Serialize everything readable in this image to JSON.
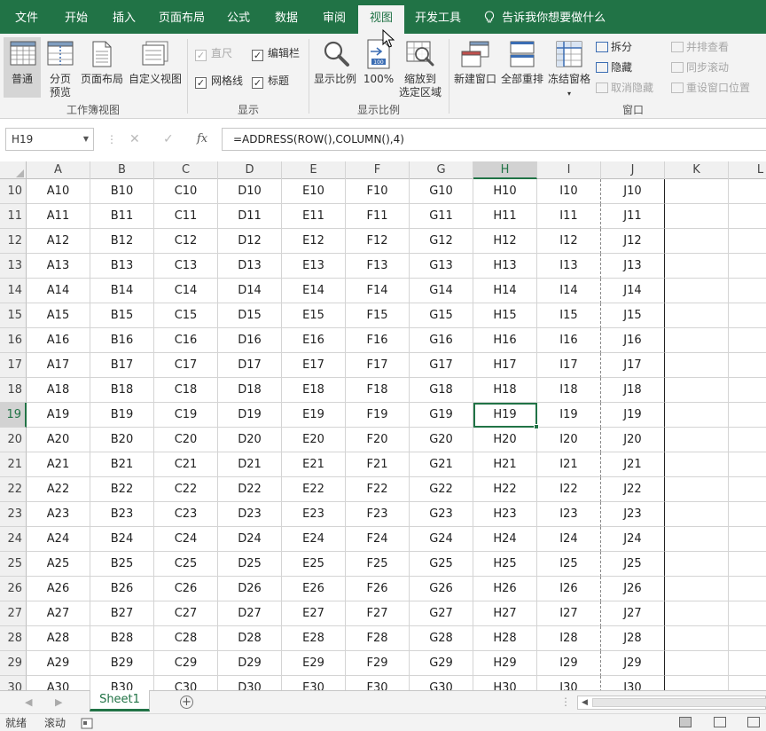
{
  "tabs": [
    {
      "label": "文件"
    },
    {
      "label": "开始"
    },
    {
      "label": "插入"
    },
    {
      "label": "页面布局"
    },
    {
      "label": "公式"
    },
    {
      "label": "数据"
    },
    {
      "label": "审阅"
    },
    {
      "label": "视图",
      "active": true
    },
    {
      "label": "开发工具"
    }
  ],
  "tell_me": "告诉我你想要做什么",
  "ribbon": {
    "workbook_views": {
      "group_label": "工作簿视图",
      "normal": "普通",
      "page_break_line1": "分页",
      "page_break_line2": "预览",
      "page_layout": "页面布局",
      "custom_views": "自定义视图"
    },
    "show": {
      "group_label": "显示",
      "ruler": "直尺",
      "formula_bar": "编辑栏",
      "gridlines": "网格线",
      "headings": "标题",
      "ruler_checked": true,
      "formula_bar_checked": true,
      "gridlines_checked": true,
      "headings_checked": true
    },
    "zoom": {
      "group_label": "显示比例",
      "zoom": "显示比例",
      "hundred": "100%",
      "zoom_sel_line1": "缩放到",
      "zoom_sel_line2": "选定区域"
    },
    "window": {
      "group_label": "窗口",
      "new_window": "新建窗口",
      "arrange_all": "全部重排",
      "freeze_panes": "冻结窗格",
      "split": "拆分",
      "hide": "隐藏",
      "unhide": "取消隐藏",
      "side_by_side": "并排查看",
      "sync_scroll": "同步滚动",
      "reset_position": "重设窗口位置"
    }
  },
  "formula_bar": {
    "name_box": "H19",
    "cancel_glyph": "✕",
    "enter_glyph": "✓",
    "fx": "fx",
    "formula": "=ADDRESS(ROW(),COLUMN(),4)"
  },
  "grid": {
    "columns": [
      "A",
      "B",
      "C",
      "D",
      "E",
      "F",
      "G",
      "H",
      "I",
      "J",
      "K",
      "L"
    ],
    "selected_column": "H",
    "selected_row": 19,
    "active_cell": "H19",
    "first_row": 10,
    "last_row": 30,
    "filled_columns": [
      "A",
      "B",
      "C",
      "D",
      "E",
      "F",
      "G",
      "H",
      "I",
      "J"
    ]
  },
  "sheets": [
    {
      "name": "Sheet1",
      "active": true
    }
  ],
  "add_sheet_glyph": "+",
  "status": {
    "ready": "就绪",
    "scroll": "滚动"
  },
  "colors": {
    "accent": "#217346",
    "ribbon_bg": "#f3f3f3",
    "header_bg": "#f0f0f0",
    "selected_header_bg": "#d2d2d2"
  }
}
